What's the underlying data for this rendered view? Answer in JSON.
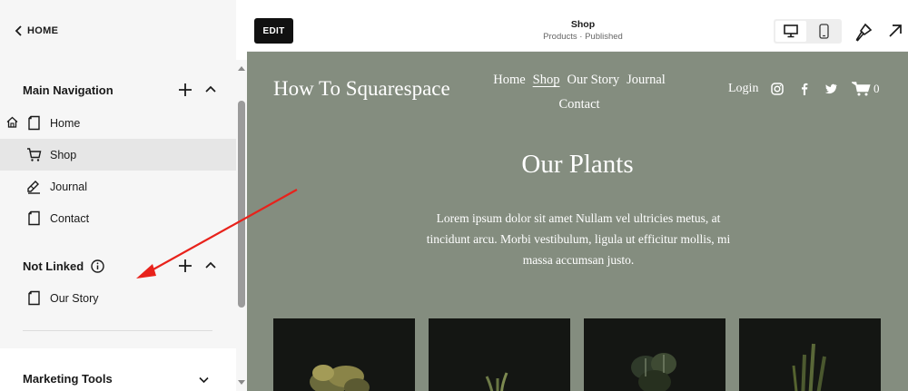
{
  "sidebar": {
    "back_label": "HOME",
    "main_navigation": {
      "title": "Main Navigation",
      "items": [
        {
          "label": "Home",
          "icon": "page-icon",
          "is_homepage": true
        },
        {
          "label": "Shop",
          "icon": "cart-icon",
          "active": true
        },
        {
          "label": "Journal",
          "icon": "blog-icon"
        },
        {
          "label": "Contact",
          "icon": "page-icon"
        }
      ]
    },
    "not_linked": {
      "title": "Not Linked",
      "items": [
        {
          "label": "Our Story",
          "icon": "page-icon"
        }
      ]
    },
    "marketing_tools": {
      "title": "Marketing Tools"
    }
  },
  "topbar": {
    "edit_label": "EDIT",
    "page_title": "Shop",
    "page_subtitle": "Products · Published",
    "active_device": "desktop"
  },
  "site": {
    "logo": "How To Squarespace",
    "nav": [
      "Home",
      "Shop",
      "Our Story",
      "Journal",
      "Contact"
    ],
    "current_nav": "Shop",
    "login_label": "Login",
    "social_icons": [
      "instagram-icon",
      "facebook-icon",
      "twitter-icon"
    ],
    "cart_count": "0",
    "hero_title": "Our Plants",
    "hero_body": "Lorem ipsum dolor sit amet Nullam vel ultricies metus, at tincidunt arcu. Morbi vestibulum, ligula ut efficitur mollis, mi massa accumsan justo."
  },
  "colors": {
    "preview_background": "#848d7f",
    "product_card_background": "#141613",
    "annotation_arrow": "#e8221b",
    "active_nav_background": "#e6e6e6"
  }
}
